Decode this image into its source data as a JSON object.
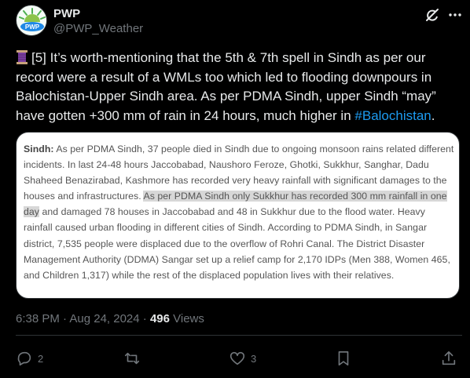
{
  "author": {
    "name": "PWP",
    "handle": "@PWP_Weather",
    "avatar_text": "PWP"
  },
  "icons": [
    "grok-icon",
    "more-icon",
    "spool-emoji-icon",
    "reply-icon",
    "retweet-icon",
    "like-icon",
    "bookmark-icon",
    "share-icon"
  ],
  "colors": {
    "background": "#000000",
    "text": "#e7e9ea",
    "muted": "#71767b",
    "link": "#1d9bf0",
    "border": "#2f3336"
  },
  "tweet": {
    "text_before": "[5] It’s worth-mentioning that the 5th & 7th spell in Sindh as per our record were a result of a WMLs too which led to flooding downpours in Balochistan-Upper Sindh area. As per PDMA Sindh, upper Sindh “may” have gotten +300 mm of rain in 24 hours, much higher in ",
    "hashtag": "#Balochistan",
    "text_after": "."
  },
  "card": {
    "label": "Sindh:",
    "text_1": " As per PDMA Sindh, 37 people died in Sindh due to ongoing monsoon rains related different incidents. In last 24-48 hours Jaccobabad, Naushoro Feroze, Ghotki, Sukkhur, Sanghar, Dadu Shaheed Benazirabad, Kashmore has recorded very heavy rainfall with significant damages to the houses and infrastructures. ",
    "highlight": "As per PDMA Sindh only Sukkhur has recorded 300 mm rainfall in one day",
    "text_2": " and damaged 78 houses in Jaccobabad and 48 in Sukkhur due to the flood water. Heavy rainfall caused urban flooding in different cities of Sindh. According to PDMA Sindh, in Sangar district, 7,535 people were displaced due to the overflow of Rohri Canal. The District Disaster Management Authority (DDMA) Sangar set up a relief camp for 2,170 IDPs (Men 388, Women 465, and Children 1,317) while the rest of the displaced population lives with their relatives."
  },
  "meta": {
    "time": "6:38 PM · Aug 24, 2024 · ",
    "views_count": "496",
    "views_label": " Views"
  },
  "actions": {
    "replies": "2",
    "retweets": "",
    "likes": "3"
  }
}
